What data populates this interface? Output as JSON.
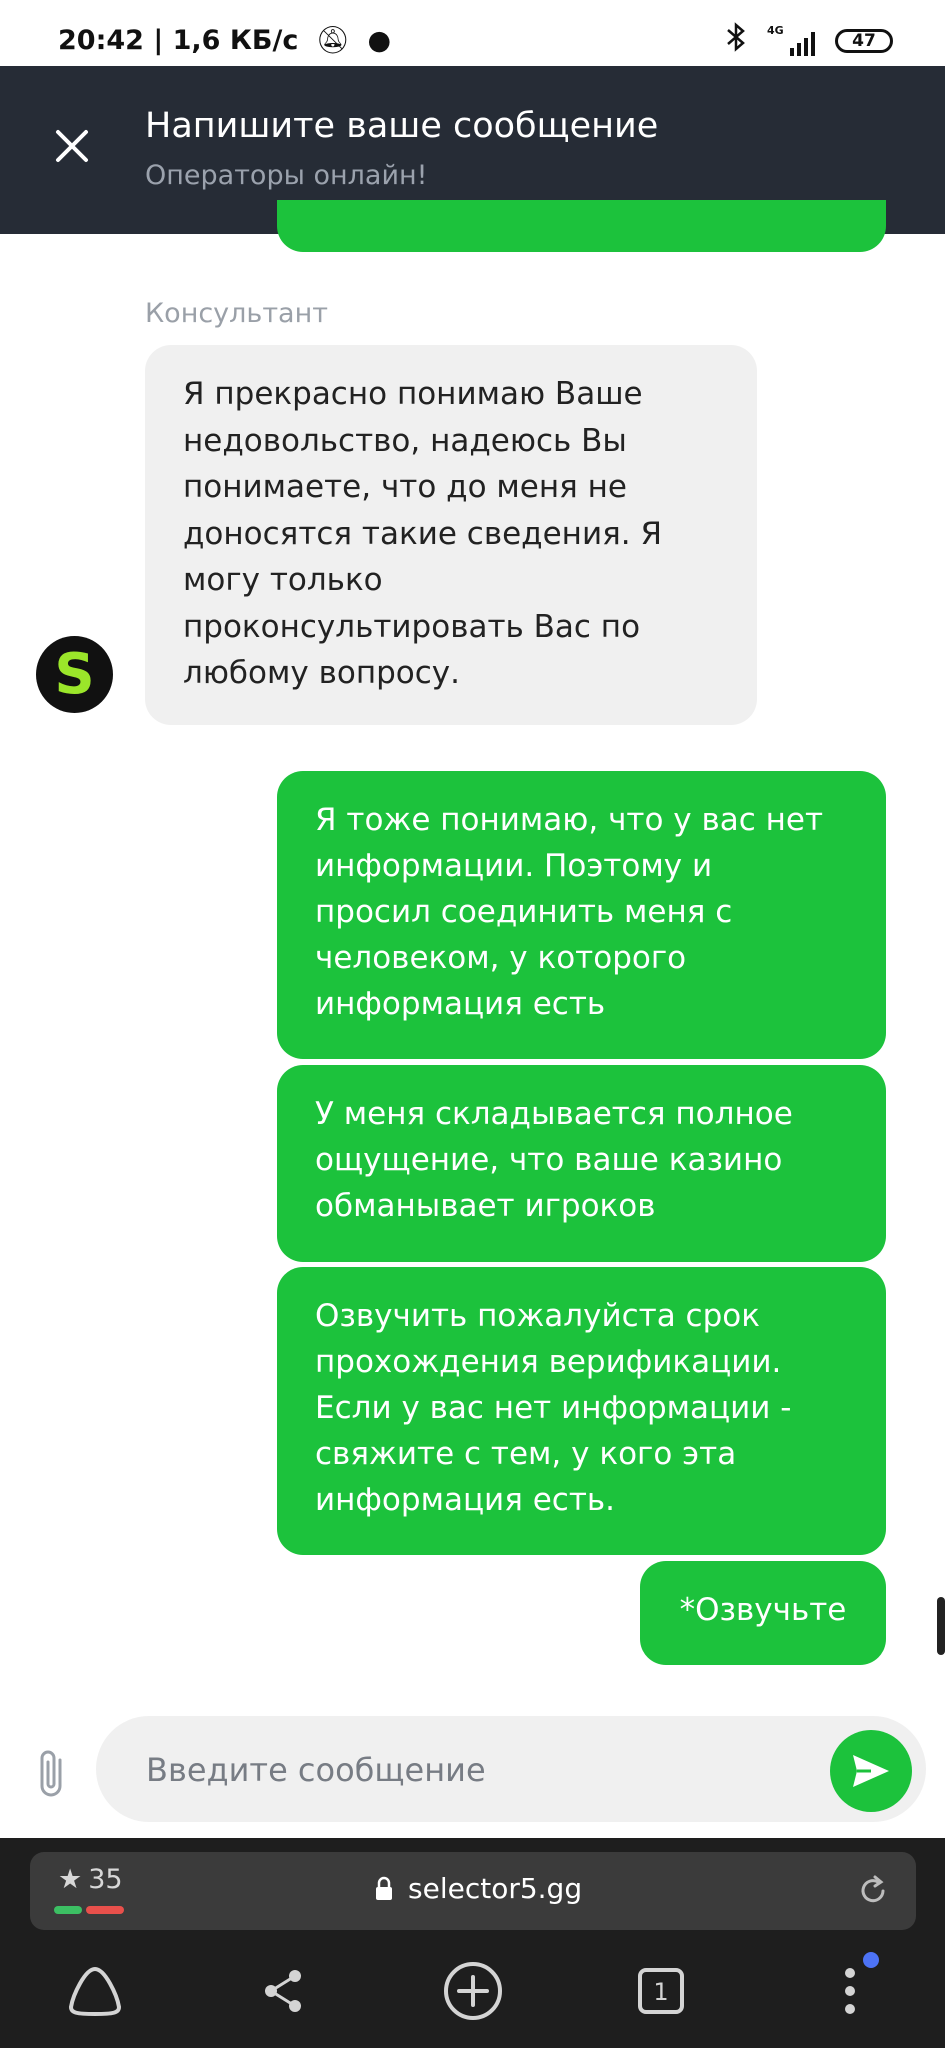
{
  "status_bar": {
    "time": "20:42",
    "speed": "1,6 КБ/с",
    "network_label": "4G",
    "battery": "47"
  },
  "header": {
    "title": "Напишите ваше сообщение",
    "subtitle": "Операторы онлайн!"
  },
  "chat": {
    "sender_label": "Консультант",
    "avatar_letter": "S",
    "agent_message": "Я прекрасно понимаю Ваше\nнедовольство, надеюсь Вы\nпонимаете, что до меня не\nдоносятся такие сведения. Я\nмогу только\nпроконсультировать Вас по\nлюбому вопросу.",
    "user_messages": [
      "Я тоже понимаю, что у вас нет\nинформации. Поэтому и\nпросил соединить меня с\nчеловеком, у которого\nинформация есть",
      "У меня складывается полное\nощущение, что ваше казино\nобманывает игроков",
      "Озвучить пожалуйста срок\nпрохождения верификации.\nЕсли у вас нет информации -\nсвяжите с тем, у кого эта\nинформация есть.",
      "*Озвучьте"
    ]
  },
  "composer": {
    "placeholder": "Введите сообщение"
  },
  "browser": {
    "rating": "35",
    "url": "selector5.gg",
    "tab_count": "1"
  },
  "colors": {
    "accent": "#1cc23c",
    "header_bg": "#262c36",
    "agent_bubble": "#f0f0f0"
  }
}
